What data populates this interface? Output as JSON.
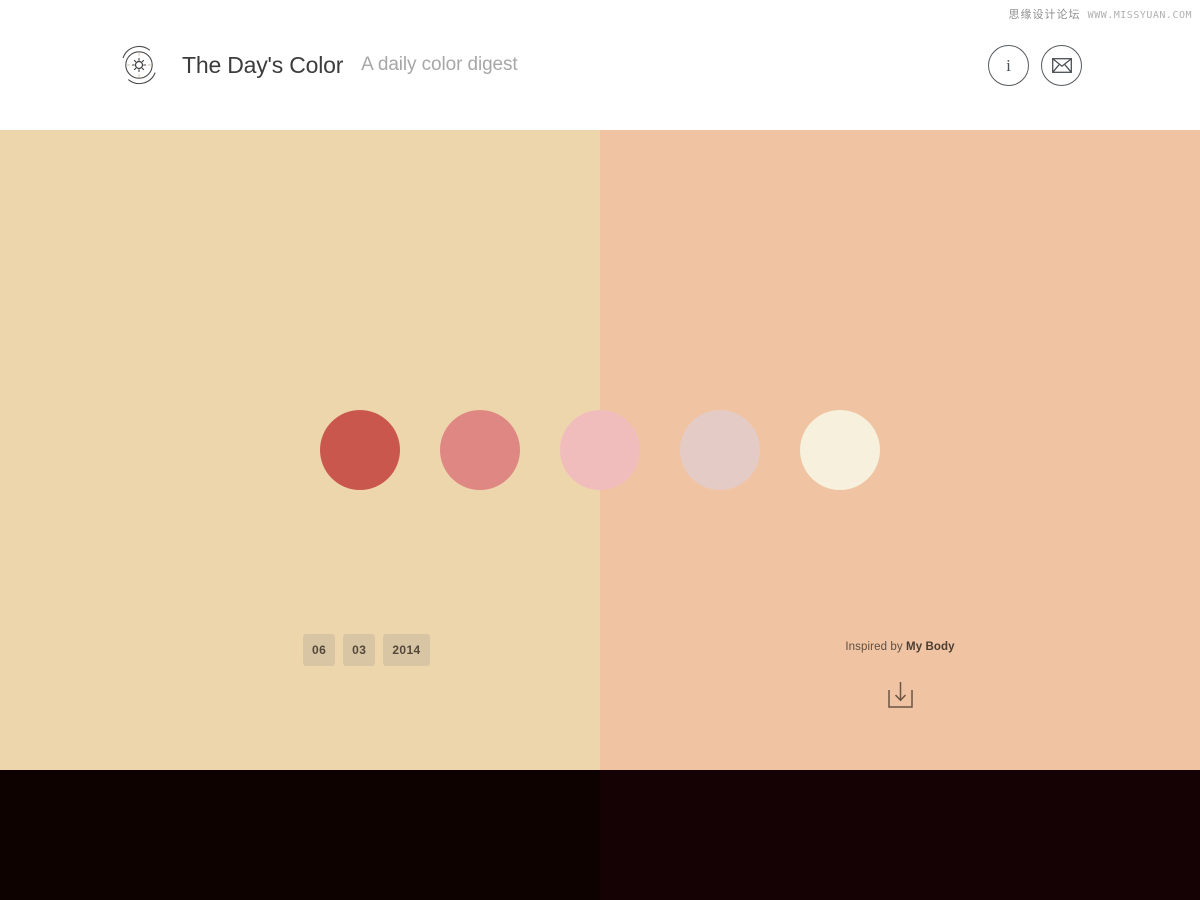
{
  "watermark": {
    "cn": "思缘设计论坛",
    "url": "WWW.MISSYUAN.COM"
  },
  "header": {
    "logo_icon": "sun-logo-icon",
    "title": "The Day's Color",
    "tagline": "A daily color digest",
    "actions": [
      {
        "name": "info-button",
        "icon": "info-icon",
        "label": "i"
      },
      {
        "name": "mail-button",
        "icon": "envelope-icon",
        "label": ""
      }
    ]
  },
  "palette": {
    "swatches": [
      {
        "name": "swatch-1",
        "hex": "#C9574D"
      },
      {
        "name": "swatch-2",
        "hex": "#DF8782"
      },
      {
        "name": "swatch-3",
        "hex": "#F0BDBC"
      },
      {
        "name": "swatch-4",
        "hex": "#E5CBC6"
      },
      {
        "name": "swatch-5",
        "hex": "#F6F0DC"
      }
    ],
    "panel_left_hex": "#EED6AC",
    "panel_right_hex": "#F0C4A2"
  },
  "date": {
    "day": "06",
    "month": "03",
    "year": "2014"
  },
  "credit": {
    "prefix": "Inspired by",
    "source": "My Body",
    "download_icon": "download-icon"
  },
  "footer": {
    "left_hex": "#0E0201",
    "right_hex": "#150204"
  }
}
